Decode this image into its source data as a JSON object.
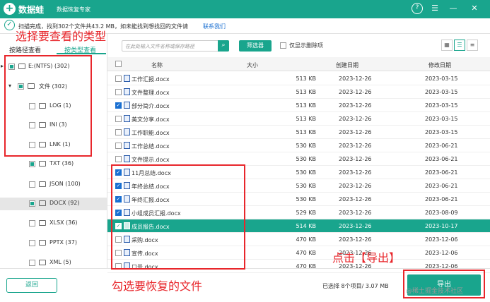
{
  "titlebar": {
    "app_name": "数据蛙",
    "app_subtitle": "数据恢复专家",
    "btn_help": "?",
    "btn_menu": "☰",
    "btn_min": "—",
    "btn_close": "✕"
  },
  "status": {
    "text": "扫描完成，找到302个文件共43.2 MB，如未能找到想找回的文件请",
    "link": "联系我们"
  },
  "left_panel": {
    "tabs": [
      {
        "label": "按路径查看"
      },
      {
        "label": "按类型查看"
      }
    ],
    "tree": [
      {
        "label": "E:(NTFS) (302)",
        "arrow": "▸",
        "check": "part"
      },
      {
        "label": "文件 (302)",
        "arrow": "▾",
        "check": "part"
      },
      {
        "label": "LOG (1)",
        "arrow": "",
        "check": "none"
      },
      {
        "label": "INI (3)",
        "arrow": "",
        "check": "none"
      },
      {
        "label": "LNK (1)",
        "arrow": "",
        "check": "none"
      },
      {
        "label": "TXT (36)",
        "arrow": "",
        "check": "part"
      },
      {
        "label": "JSON (100)",
        "arrow": "",
        "check": "none"
      },
      {
        "label": "DOCX (92)",
        "arrow": "",
        "check": "part"
      },
      {
        "label": "XLSX (36)",
        "arrow": "",
        "check": "none"
      },
      {
        "label": "PPTX (37)",
        "arrow": "",
        "check": "none"
      },
      {
        "label": "XML (5)",
        "arrow": "",
        "check": "none"
      }
    ]
  },
  "toolbar": {
    "search_placeholder": "在此处输入文件名称或保存路径",
    "search_icon": "magnifier-icon",
    "filter_label": "筛选器",
    "deleted_only_label": "仅显示删除项",
    "view_icons": [
      "grid-view-icon",
      "list-view-icon",
      "detail-view-icon"
    ]
  },
  "table": {
    "headers": {
      "name": "名称",
      "size": "大小",
      "created": "创建日期",
      "modified": "修改日期"
    },
    "rows": [
      {
        "name": "工作汇报.docx",
        "size": "513 KB",
        "created": "2023-12-26",
        "modified": "2023-03-15",
        "checked": false,
        "selected": false
      },
      {
        "name": "文件整理.docx",
        "size": "513 KB",
        "created": "2023-12-26",
        "modified": "2023-03-15",
        "checked": false,
        "selected": false
      },
      {
        "name": "部分简介.docx",
        "size": "513 KB",
        "created": "2023-12-26",
        "modified": "2023-03-15",
        "checked": true,
        "selected": false
      },
      {
        "name": "美文分享.docx",
        "size": "513 KB",
        "created": "2023-12-26",
        "modified": "2023-03-15",
        "checked": false,
        "selected": false
      },
      {
        "name": "工作职能.docx",
        "size": "513 KB",
        "created": "2023-12-26",
        "modified": "2023-03-15",
        "checked": false,
        "selected": false
      },
      {
        "name": "工作总结.docx",
        "size": "530 KB",
        "created": "2023-12-26",
        "modified": "2023-06-21",
        "checked": false,
        "selected": false
      },
      {
        "name": "文件提示.docx",
        "size": "530 KB",
        "created": "2023-12-26",
        "modified": "2023-06-21",
        "checked": false,
        "selected": false
      },
      {
        "name": "11月总结.docx",
        "size": "530 KB",
        "created": "2023-12-26",
        "modified": "2023-06-21",
        "checked": true,
        "selected": false
      },
      {
        "name": "年终总结.docx",
        "size": "530 KB",
        "created": "2023-12-26",
        "modified": "2023-06-21",
        "checked": true,
        "selected": false
      },
      {
        "name": "年终汇报.docx",
        "size": "530 KB",
        "created": "2023-12-26",
        "modified": "2023-06-21",
        "checked": true,
        "selected": false
      },
      {
        "name": "小组成员汇报.docx",
        "size": "529 KB",
        "created": "2023-12-26",
        "modified": "2023-08-09",
        "checked": true,
        "selected": false
      },
      {
        "name": "成员报告.docx",
        "size": "514 KB",
        "created": "2023-12-26",
        "modified": "2023-10-17",
        "checked": true,
        "selected": true
      },
      {
        "name": "采购.docx",
        "size": "470 KB",
        "created": "2023-12-26",
        "modified": "2023-12-06",
        "checked": false,
        "selected": false
      },
      {
        "name": "宣传.docx",
        "size": "470 KB",
        "created": "2023-12-26",
        "modified": "2023-12-06",
        "checked": false,
        "selected": false
      },
      {
        "name": "口号.docx",
        "size": "470 KB",
        "created": "2023-12-26",
        "modified": "2023-12-06",
        "checked": false,
        "selected": false
      }
    ]
  },
  "footer": {
    "back_label": "返回",
    "selection_info": "已选择 8个项目/ 3.07 MB",
    "export_label": "导出"
  },
  "annotations": {
    "choose_type": "选择要查看的类型",
    "choose_files": "勾选要恢复的文件",
    "click_export": "点击【导出】"
  },
  "watermark": "@稀土掘金技术社区",
  "colors": {
    "accent": "#19a58d",
    "annotation": "#e8262b",
    "link": "#1a6fd1"
  }
}
